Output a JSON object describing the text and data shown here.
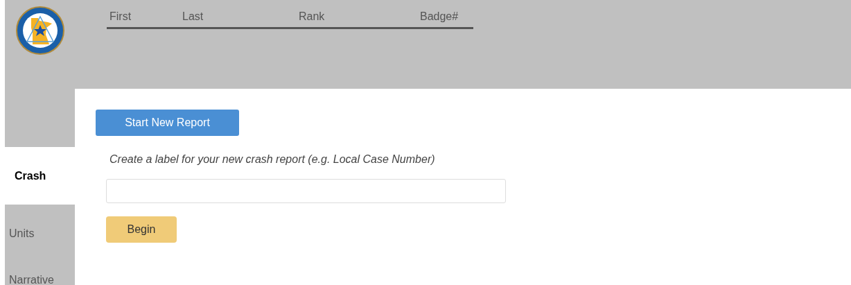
{
  "header": {
    "name_fields": [
      {
        "label": "First"
      },
      {
        "label": "Last"
      },
      {
        "label": "Rank"
      },
      {
        "label": "Badge#"
      }
    ]
  },
  "sidebar": {
    "items": [
      {
        "label": "Crash",
        "selected": true
      },
      {
        "label": "Units",
        "selected": false
      },
      {
        "label": "Narrative",
        "selected": false
      }
    ]
  },
  "main": {
    "start_button": "Start New Report",
    "prompt": "Create a label for your new crash report (e.g. Local Case Number)",
    "begin_button": "Begin"
  }
}
